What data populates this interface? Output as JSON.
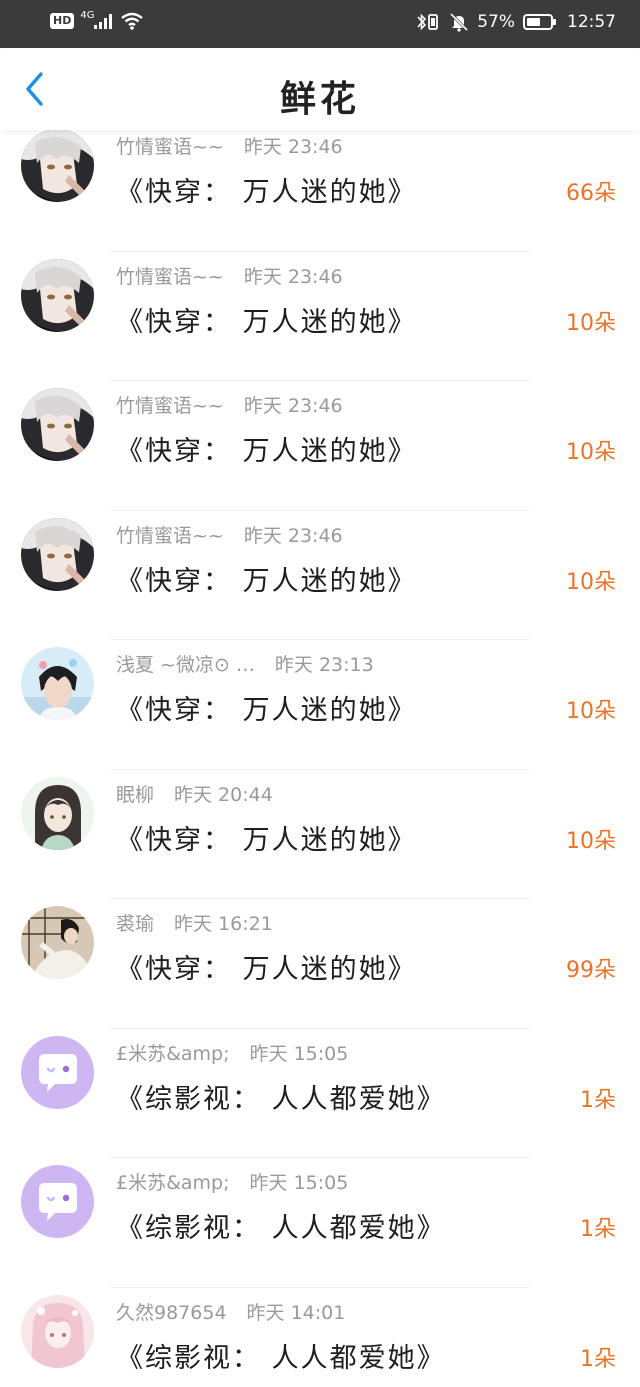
{
  "status_bar": {
    "hd": "HD",
    "network": "4G",
    "battery_pct": "57%",
    "battery_level": 0.57,
    "time": "12:57"
  },
  "header": {
    "title": "鲜花",
    "back_icon": "chevron-left-icon",
    "accent": "#1a8fe8"
  },
  "colors": {
    "count": "#e8742a",
    "meta": "#9a9a9a"
  },
  "items": [
    {
      "name": "竹情蜜语~~",
      "time": "昨天 23:46",
      "book": "《快穿： 万人迷的她》",
      "count": "66朵",
      "avatar": "avatar-anime-boy"
    },
    {
      "name": "竹情蜜语~~",
      "time": "昨天 23:46",
      "book": "《快穿： 万人迷的她》",
      "count": "10朵",
      "avatar": "avatar-anime-boy"
    },
    {
      "name": "竹情蜜语~~",
      "time": "昨天 23:46",
      "book": "《快穿： 万人迷的她》",
      "count": "10朵",
      "avatar": "avatar-anime-boy"
    },
    {
      "name": "竹情蜜语~~",
      "time": "昨天 23:46",
      "book": "《快穿： 万人迷的她》",
      "count": "10朵",
      "avatar": "avatar-anime-boy"
    },
    {
      "name": "浅夏 ~微凉⊙ …",
      "time": "昨天 23:13",
      "book": "《快穿： 万人迷的她》",
      "count": "10朵",
      "avatar": "avatar-boy-photo"
    },
    {
      "name": "眠柳",
      "time": "昨天 20:44",
      "book": "《快穿： 万人迷的她》",
      "count": "10朵",
      "avatar": "avatar-girl-illustration"
    },
    {
      "name": "裘瑜",
      "time": "昨天 16:21",
      "book": "《快穿： 万人迷的她》",
      "count": "99朵",
      "avatar": "avatar-costume-photo"
    },
    {
      "name": "£米苏&amp;",
      "time": "昨天 15:05",
      "book": "《综影视： 人人都爱她》",
      "count": "1朵",
      "avatar": "avatar-default-chat"
    },
    {
      "name": "£米苏&amp;",
      "time": "昨天 15:05",
      "book": "《综影视： 人人都爱她》",
      "count": "1朵",
      "avatar": "avatar-default-chat"
    },
    {
      "name": "久然987654",
      "time": "昨天 14:01",
      "book": "《综影视： 人人都爱她》",
      "count": "1朵",
      "avatar": "avatar-pink-girl"
    }
  ]
}
